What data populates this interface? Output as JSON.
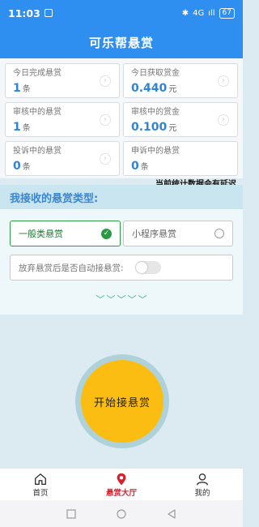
{
  "status_bar": {
    "time": "11:03",
    "network": "4G",
    "signal": "ıll",
    "battery": "67"
  },
  "header": {
    "title": "可乐帮悬赏"
  },
  "stats": [
    {
      "label": "今日完成悬赏",
      "value": "1",
      "unit": "条"
    },
    {
      "label": "今日获取赏金",
      "value": "0.440",
      "unit": "元"
    },
    {
      "label": "审核中的悬赏",
      "value": "1",
      "unit": "条"
    },
    {
      "label": "审核中的赏金",
      "value": "0.100",
      "unit": "元"
    },
    {
      "label": "投诉中的悬赏",
      "value": "0",
      "unit": "条"
    },
    {
      "label": "申诉中的悬赏",
      "value": "0",
      "unit": "条"
    }
  ],
  "delay_note": "当前统计数据会有延迟",
  "reward_types": {
    "title": "我接收的悬赏类型:",
    "options": [
      {
        "label": "一般类悬赏",
        "selected": true
      },
      {
        "label": "小程序悬赏",
        "selected": false
      }
    ],
    "auto_accept_label": "放弃悬赏后是否自动接悬赏:",
    "auto_accept_enabled": false
  },
  "start_button": {
    "label": "开始接悬赏"
  },
  "tabbar": {
    "items": [
      {
        "label": "首页",
        "icon": "home-icon",
        "active": false
      },
      {
        "label": "悬赏大厅",
        "icon": "location-pin-icon",
        "active": true
      },
      {
        "label": "我的",
        "icon": "user-icon",
        "active": false
      }
    ]
  },
  "colors": {
    "primary": "#2f8ff0",
    "value_blue": "#2f84d8",
    "selected_green": "#2a9a43",
    "start_yellow": "#fbbd11",
    "active_tab_red": "#d8202c"
  }
}
